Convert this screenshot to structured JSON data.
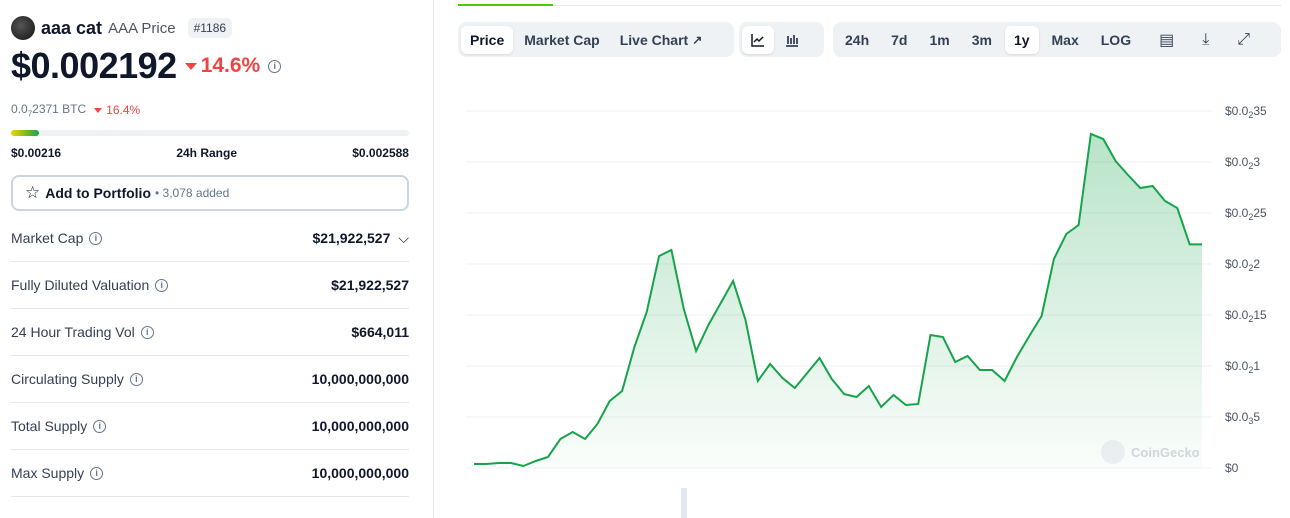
{
  "coin": {
    "name": "aaa cat",
    "symbol_label": "AAA Price",
    "rank": "#1186",
    "price": "$0.002192",
    "change_24h": "14.6%",
    "btc_price_prefix": "0.0",
    "btc_price_sub": "7",
    "btc_price_rest": "2371 BTC",
    "btc_change": "16.4%",
    "range_progress": 0.07,
    "range_low": "$0.00216",
    "range_label": "24h Range",
    "range_high": "$0.002588"
  },
  "portfolio": {
    "label": "Add to Portfolio",
    "added": "• 3,078 added"
  },
  "stats": [
    {
      "label": "Market Cap",
      "value": "$21,922,527",
      "expand": true
    },
    {
      "label": "Fully Diluted Valuation",
      "value": "$21,922,527"
    },
    {
      "label": "24 Hour Trading Vol",
      "value": "$664,011"
    },
    {
      "label": "Circulating Supply",
      "value": "10,000,000,000"
    },
    {
      "label": "Total Supply",
      "value": "10,000,000,000"
    },
    {
      "label": "Max Supply",
      "value": "10,000,000,000"
    }
  ],
  "toolbar": {
    "tabs": [
      "Price",
      "Market Cap",
      "Live Chart"
    ],
    "active_tab": "Price",
    "chart_types": [
      "line-chart-icon",
      "candlestick-icon"
    ],
    "ranges": [
      "24h",
      "7d",
      "1m",
      "3m",
      "1y",
      "Max",
      "LOG"
    ],
    "active_range": "1y"
  },
  "chart_data": {
    "type": "area",
    "ylim": [
      0,
      0.0035
    ],
    "yticks": [
      {
        "v": 0.0035,
        "label": [
          "$0.0",
          "2",
          "35"
        ]
      },
      {
        "v": 0.003,
        "label": [
          "$0.0",
          "2",
          "3"
        ]
      },
      {
        "v": 0.0025,
        "label": [
          "$0.0",
          "2",
          "25"
        ]
      },
      {
        "v": 0.002,
        "label": [
          "$0.0",
          "2",
          "2"
        ]
      },
      {
        "v": 0.0015,
        "label": [
          "$0.0",
          "2",
          "15"
        ]
      },
      {
        "v": 0.001,
        "label": [
          "$0.0",
          "2",
          "1"
        ]
      },
      {
        "v": 0.0005,
        "label": [
          "$0.0",
          "3",
          "5"
        ]
      },
      {
        "v": 0,
        "label": [
          "$0",
          "",
          ""
        ]
      }
    ],
    "values": [
      3.9e-05,
      3.9e-05,
      4.9e-05,
      4.9e-05,
      2e-05,
      6.9e-05,
      0.000108,
      0.000284,
      0.000353,
      0.000284,
      0.000431,
      0.000657,
      0.000755,
      0.001186,
      0.001529,
      0.002078,
      0.002137,
      0.001559,
      0.001147,
      0.001402,
      0.001618,
      0.001833,
      0.001451,
      0.000853,
      0.00102,
      0.000882,
      0.000784,
      0.000931,
      0.001078,
      0.000873,
      0.000725,
      0.000696,
      0.000804,
      0.000598,
      0.000716,
      0.000618,
      0.000627,
      0.001304,
      0.001284,
      0.001039,
      0.001098,
      0.000961,
      0.000961,
      0.000853,
      0.001088,
      0.001294,
      0.00149,
      0.002049,
      0.002294,
      0.002382,
      0.003275,
      0.003225,
      0.00301,
      0.002873,
      0.002745,
      0.002765,
      0.002618,
      0.002549,
      0.002192,
      0.002192
    ],
    "line_color": "#16a34a",
    "watermark": "CoinGecko"
  }
}
